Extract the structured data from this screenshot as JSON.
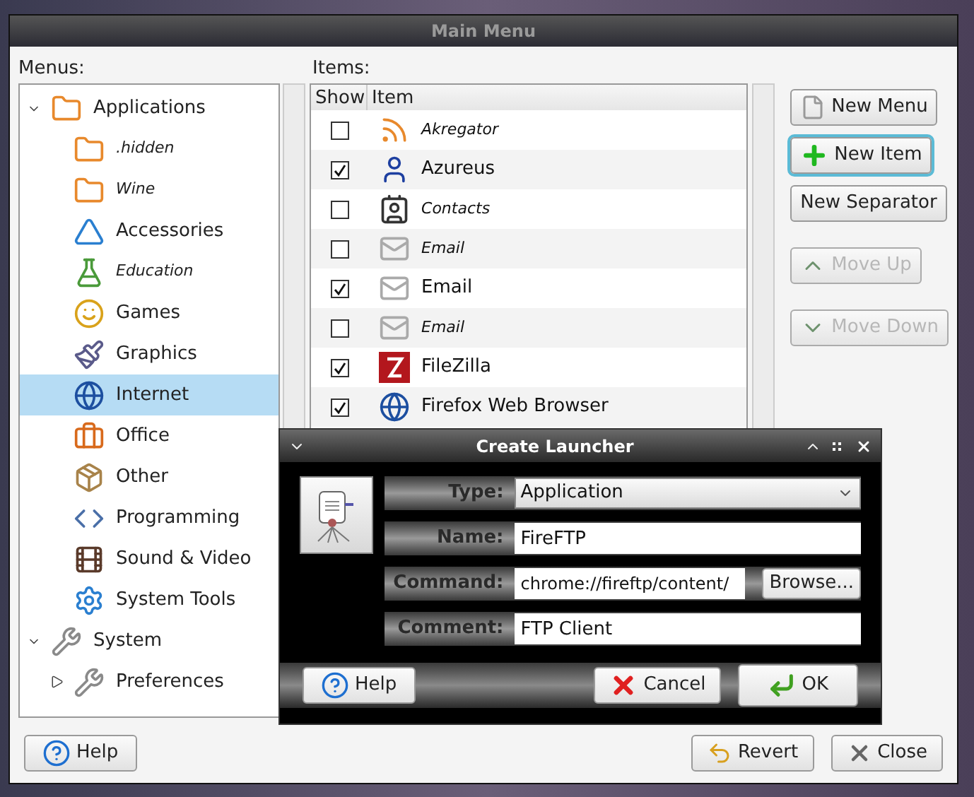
{
  "window": {
    "title": "Main Menu"
  },
  "menus": {
    "label": "Menus:",
    "tree": [
      {
        "label": "Applications",
        "expanded": true,
        "hidden": false,
        "selected": false,
        "children": [
          {
            "label": ".hidden",
            "hidden": true,
            "selected": false
          },
          {
            "label": "Wine",
            "hidden": true,
            "selected": false
          },
          {
            "label": "Accessories",
            "hidden": false,
            "selected": false
          },
          {
            "label": "Education",
            "hidden": true,
            "selected": false
          },
          {
            "label": "Games",
            "hidden": false,
            "selected": false
          },
          {
            "label": "Graphics",
            "hidden": false,
            "selected": false
          },
          {
            "label": "Internet",
            "hidden": false,
            "selected": true
          },
          {
            "label": "Office",
            "hidden": false,
            "selected": false
          },
          {
            "label": "Other",
            "hidden": false,
            "selected": false
          },
          {
            "label": "Programming",
            "hidden": false,
            "selected": false
          },
          {
            "label": "Sound & Video",
            "hidden": false,
            "selected": false
          },
          {
            "label": "System Tools",
            "hidden": false,
            "selected": false
          }
        ]
      },
      {
        "label": "System",
        "expanded": true,
        "hidden": false,
        "selected": false,
        "children": [
          {
            "label": "Preferences",
            "expanded": false,
            "hidden": false,
            "selected": false
          }
        ]
      }
    ]
  },
  "items": {
    "label": "Items:",
    "columns": [
      "Show",
      "Item"
    ],
    "rows": [
      {
        "name": "Akregator",
        "checked": false
      },
      {
        "name": "Azureus",
        "checked": true
      },
      {
        "name": "Contacts",
        "checked": false
      },
      {
        "name": "Email",
        "checked": false
      },
      {
        "name": "Email",
        "checked": true
      },
      {
        "name": "Email",
        "checked": false
      },
      {
        "name": "FileZilla",
        "checked": true
      },
      {
        "name": "Firefox Web Browser",
        "checked": true
      }
    ]
  },
  "side_buttons": [
    {
      "label": "New Menu",
      "disabled": false,
      "focused": false
    },
    {
      "label": "New Item",
      "disabled": false,
      "focused": true
    },
    {
      "label": "New Separator",
      "disabled": false,
      "focused": false
    },
    {
      "label": "Move Up",
      "disabled": true,
      "focused": false
    },
    {
      "label": "Move Down",
      "disabled": true,
      "focused": false
    }
  ],
  "bottom_buttons": {
    "help": "Help",
    "revert": "Revert",
    "close": "Close"
  },
  "dialog": {
    "title": "Create Launcher",
    "fields": [
      {
        "kind": "select",
        "label": "Type:",
        "value": "Application"
      },
      {
        "kind": "text",
        "label": "Name:",
        "value": "FireFTP"
      },
      {
        "kind": "browse",
        "label": "Command:",
        "value": "chrome://fireftp/content/",
        "button": "Browse..."
      },
      {
        "kind": "text",
        "label": "Comment:",
        "value": "FTP Client"
      }
    ],
    "buttons": {
      "help": "Help",
      "cancel": "Cancel",
      "ok": "OK"
    }
  }
}
